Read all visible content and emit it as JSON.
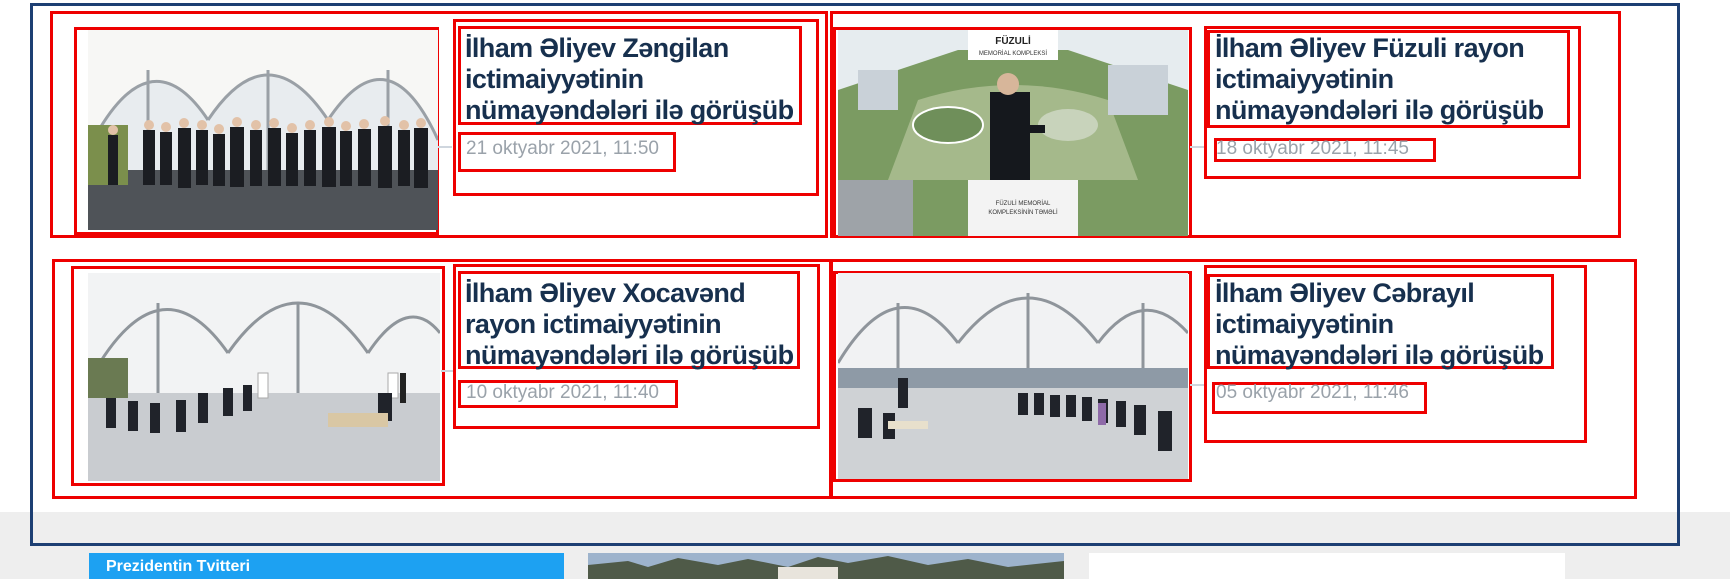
{
  "news": [
    {
      "title": "İlham Əliyev Zəngilan ictimaiyyətinin nümayəndələri ilə görüşüb",
      "date": "21 oktyabr 2021, 11:50",
      "photo": "tent-meeting-standing-crowd"
    },
    {
      "title": "İlham Əliyev Füzuli rayon ictimaiyyətinin nümayəndələri ilə görüşüb",
      "date": "18 oktyabr 2021, 11:45",
      "photo": "memorial-complex-capsule",
      "photo_sign": "FÜZULİ MEMORİAL KOMPLEKSİ"
    },
    {
      "title": "İlham Əliyev Xocavənd rayon ictimaiyyətinin nümayəndələri ilə görüşüb",
      "date": "10 oktyabr 2021, 11:40",
      "photo": "tent-meeting-seated"
    },
    {
      "title": "İlham Əliyev Cəbrayıl ictimaiyyətinin nümayəndələri ilə görüşüb",
      "date": "05 oktyabr 2021, 11:46",
      "photo": "tent-meeting-seated-wide"
    }
  ],
  "bottom": {
    "twitter_title": "Prezidentin Tvitteri"
  },
  "colors": {
    "title": "#17304e",
    "date": "#9aa2aa",
    "frame": "#1d3f73",
    "highlight": "#ee0000",
    "twitter": "#1da1f2"
  }
}
